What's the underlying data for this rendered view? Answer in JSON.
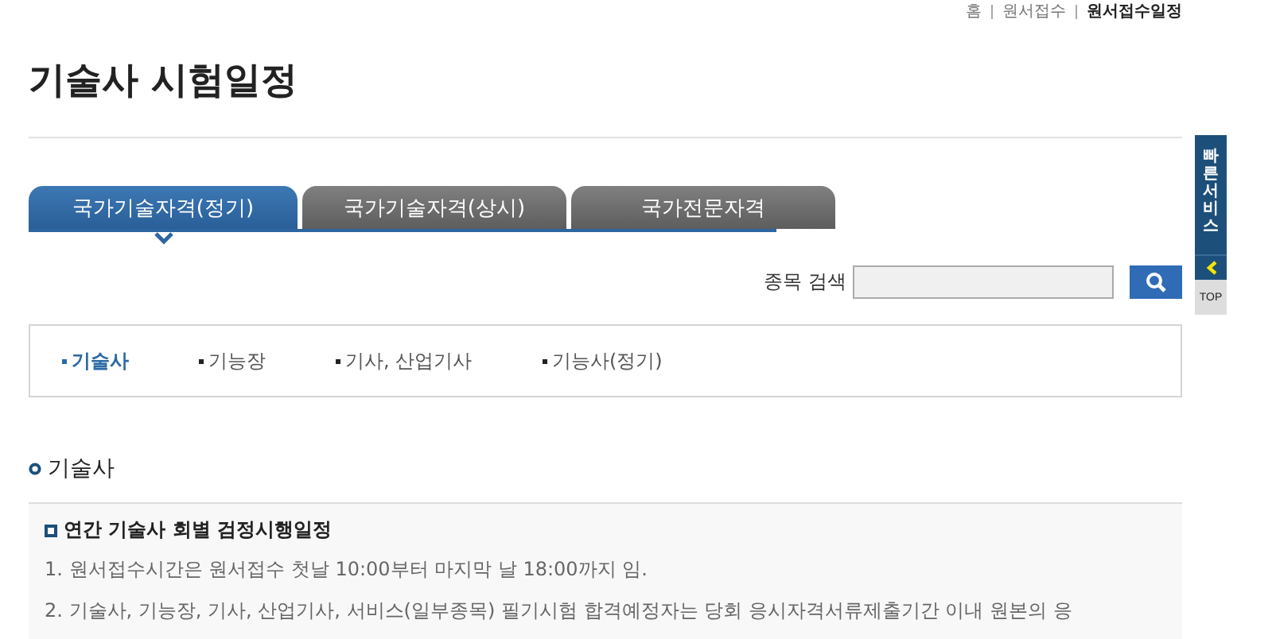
{
  "breadcrumb": [
    {
      "label": "홈",
      "current": false
    },
    {
      "label": "원서접수",
      "current": false
    },
    {
      "label": "원서접수일정",
      "current": true
    }
  ],
  "title": "기술사 시험일정",
  "tabs": [
    {
      "label": "국가기술자격(정기)",
      "selected": true
    },
    {
      "label": "국가기술자격(상시)",
      "selected": false
    },
    {
      "label": "국가전문자격",
      "selected": false
    }
  ],
  "search": {
    "label": "종목 검색"
  },
  "categories": [
    {
      "label": "기술사",
      "selected": true
    },
    {
      "label": "기능장",
      "selected": false
    },
    {
      "label": "기사, 산업기사",
      "selected": false
    },
    {
      "label": "기능사(정기)",
      "selected": false
    }
  ],
  "section_title": "기술사",
  "notice": {
    "title": "연간 기술사 회별 검정시행일정",
    "lines": [
      "1. 원서접수시간은 원서접수 첫날 10:00부터 마지막 날 18:00까지 임.",
      "2. 기술사, 기능장, 기사, 산업기사, 서비스(일부종목) 필기시험 합격예정자는 당회 응시자격서류제출기간 이내 원본의 응"
    ]
  },
  "quick_menu": {
    "label": "빠른서비스",
    "top": "TOP"
  }
}
